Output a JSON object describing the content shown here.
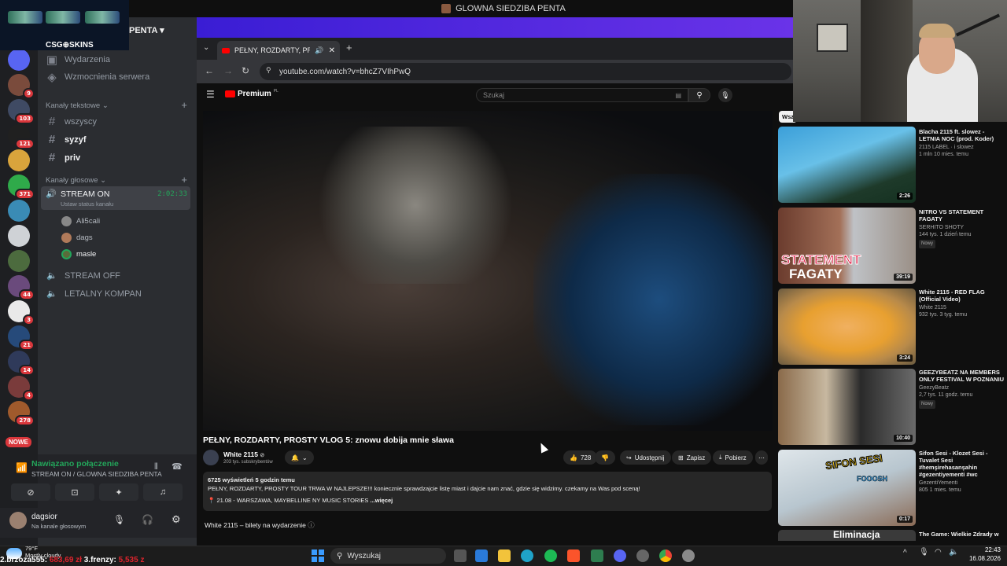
{
  "os_title": "GLOWNA SIEDZIBA PENTA",
  "csgo_banner": "CSG⊕SKINS",
  "discord": {
    "server_name": "PENTA",
    "server_badges": [
      "9",
      "103",
      "121",
      "371",
      "44",
      "3",
      "21",
      "14",
      "4",
      "278"
    ],
    "new_label": "NOWE",
    "menu": [
      "Wydarzenia",
      "Wzmocnienia serwera"
    ],
    "text_category": "Kanały tekstowe",
    "text_channels": [
      "wszyscy",
      "syzyf",
      "priv"
    ],
    "voice_category": "Kanały głosowe",
    "active_channel": {
      "name": "STREAM ON",
      "timer": "2:02:33",
      "status": "Ustaw status kanału"
    },
    "voice_users": [
      "Ali5cali",
      "dags",
      "masle"
    ],
    "voice_channels": [
      "STREAM OFF",
      "LETALNY KOMPAN"
    ],
    "connection": {
      "title": "Nawiązano połączenie",
      "subtitle": "STREAM ON / GLOWNA SIEDZIBA PENTA"
    },
    "user": {
      "name": "dagsior",
      "status": "Na kanale głosowym"
    }
  },
  "browser": {
    "tab_title": "PEŁNY, ROZDARTY, PROSTY",
    "url": "youtube.com/watch?v=bhcZ7VIhPwQ"
  },
  "youtube": {
    "logo": "Premium",
    "region": "PL",
    "search_placeholder": "Szukaj",
    "video_title": "PEŁNY, ROZDARTY, PROSTY VLOG 5: znowu dobija mnie sława",
    "channel": "White 2115",
    "subscribers": "203 tys. subskrybentów",
    "likes": "728",
    "share": "Udostępnij",
    "save": "Zapisz",
    "download": "Pobierz",
    "desc_stats": "6725 wyświetleń  5 godzin temu",
    "desc_text": "PEŁNY, ROZDARTY, PROSTY TOUR TRWA W NAJLEPSZE!!! koniecznie sprawdzajcie listę miast i dajcie nam znać, gdzie się widzimy. czekamy na Was pod sceną!",
    "desc_event": "21.08 - WARSZAWA, MAYBELLINE NY MUSIC STORIES",
    "desc_more": "...więcej",
    "tickets": "White 2115 – bilety na wydarzenie",
    "chip": "Wsz",
    "recommendations": [
      {
        "title": "Blacha 2115 ft. slowez - LETNIA NOC (prod. Koder)",
        "channel": "2115 LABEL · i slowez",
        "meta": "1 mln  10 mies. temu",
        "duration": "2:26",
        "badge": ""
      },
      {
        "title": "NITRO VS STATEMENT FAGATY",
        "channel": "SERHITO SHOTY",
        "meta": "144 tys.  1 dzień temu",
        "duration": "39:19",
        "badge": "Nowy"
      },
      {
        "title": "White 2115 - RED FLAG (Official Video)",
        "channel": "White 2115",
        "meta": "932 tys.  3 tyg. temu",
        "duration": "3:24",
        "badge": ""
      },
      {
        "title": "GEEZYBEATZ NA MEMBERS ONLY FESTIVAL W POZNANIU",
        "channel": "GeezyBeatz",
        "meta": "2,7 tys.  11 godz. temu",
        "duration": "10:40",
        "badge": "Nowy"
      },
      {
        "title": "Sifon Sesi - Klozet Sesi - Tuvalet Sesi #hemşirehasanşahin #gezentiyementi #wc",
        "channel": "GezentiYementi",
        "meta": "805  1 mies. temu",
        "duration": "0:17",
        "badge": ""
      },
      {
        "title": "The Game: Wielkie Zdrady w",
        "channel": "",
        "meta": "",
        "duration": "",
        "badge": ""
      }
    ],
    "thumb_texts": [
      "STATEMENT",
      "FAGATY",
      "SIFON SESI",
      "FOOOSH",
      "Eliminacja"
    ]
  },
  "taskbar": {
    "search": "Wyszukaj",
    "time": "22:43",
    "date": "16.08.2026",
    "weather_temp": "79°F",
    "weather_desc": "Mostly cloudy"
  },
  "ticker": {
    "p2": "2.brzoza555:",
    "p2_val": "683,69 zł",
    "p3": "3.frenzy:",
    "p3_val": "5,535 z"
  }
}
